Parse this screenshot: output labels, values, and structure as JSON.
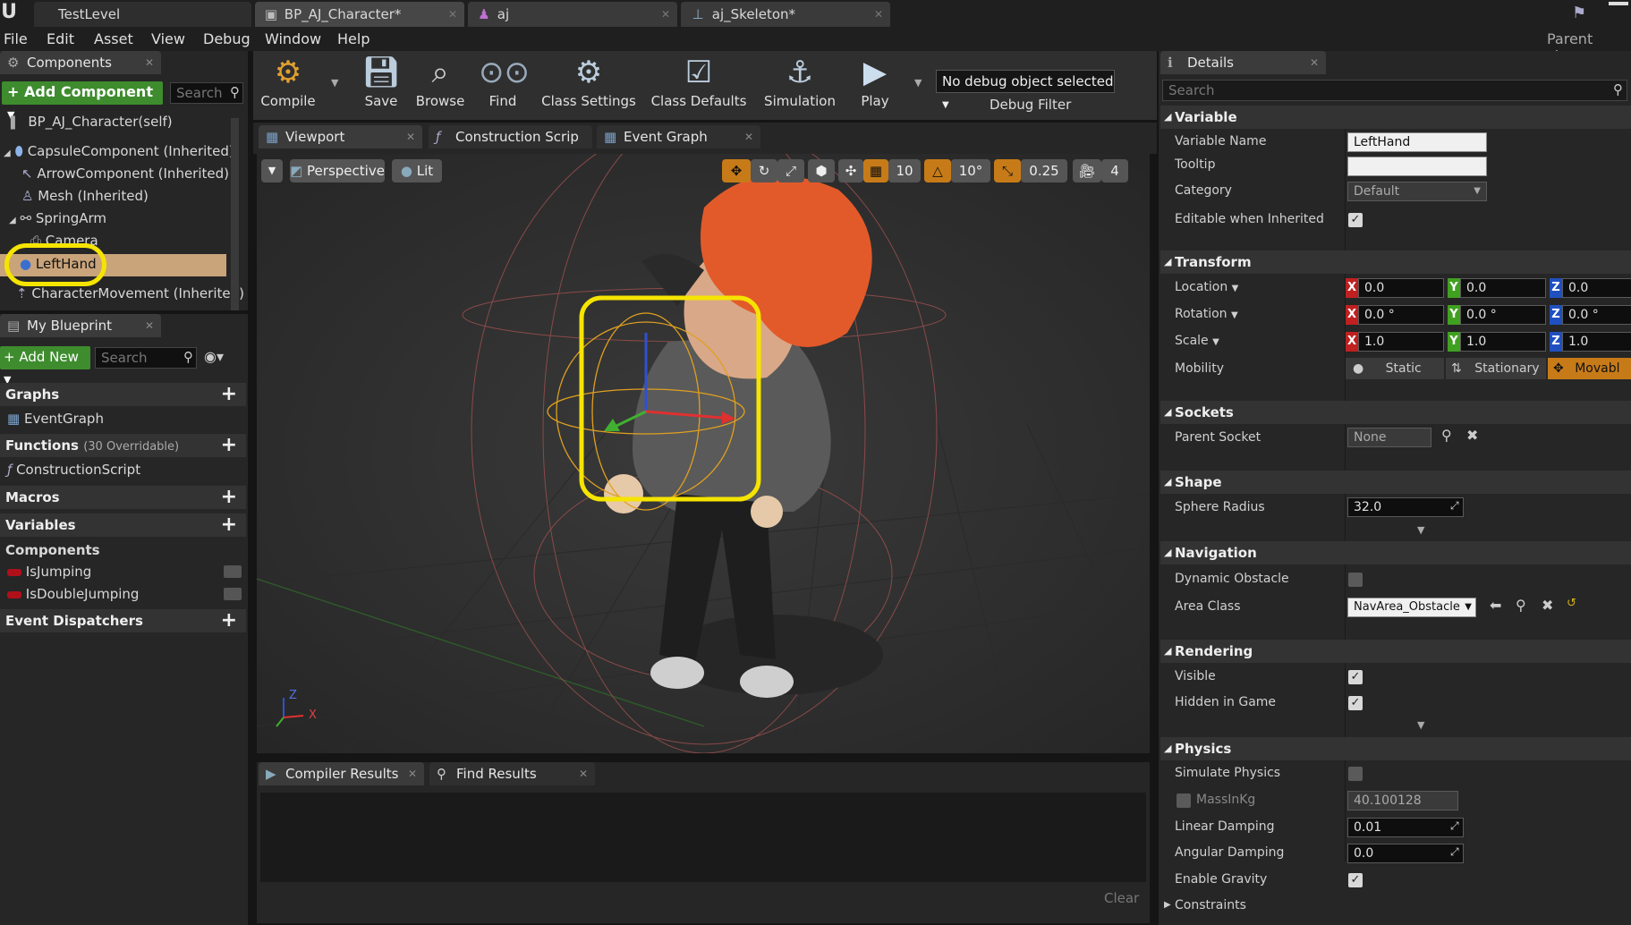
{
  "title_tabs": [
    {
      "label": "TestLevel"
    },
    {
      "label": "BP_AJ_Character*"
    },
    {
      "label": "aj"
    },
    {
      "label": "aj_Skeleton*"
    }
  ],
  "menu": [
    "File",
    "Edit",
    "Asset",
    "View",
    "Debug",
    "Window",
    "Help"
  ],
  "parent_class_label": "Parent class:",
  "components_panel": {
    "tab_label": "Components",
    "add_component_label": "+ Add Component",
    "search_placeholder": "Search",
    "self_label": "BP_AJ_Character(self)",
    "items": [
      {
        "label": "CapsuleComponent (Inherited)"
      },
      {
        "label": "ArrowComponent (Inherited)"
      },
      {
        "label": "Mesh (Inherited)"
      },
      {
        "label": "SpringArm"
      },
      {
        "label": "Camera"
      },
      {
        "label": "LeftHand"
      },
      {
        "label": "CharacterMovement (Inherited)"
      }
    ]
  },
  "my_blueprint": {
    "tab_label": "My Blueprint",
    "add_new_label": "+ Add New",
    "search_placeholder": "Search",
    "graphs_label": "Graphs",
    "event_graph_label": "EventGraph",
    "functions_label": "Functions",
    "functions_count": "(30 Overridable)",
    "construction_script_label": "ConstructionScript",
    "macros_label": "Macros",
    "variables_label": "Variables",
    "components_label": "Components",
    "variables": [
      {
        "label": "IsJumping"
      },
      {
        "label": "IsDoubleJumping"
      }
    ],
    "event_dispatchers_label": "Event Dispatchers"
  },
  "toolbar": {
    "compile": "Compile",
    "save": "Save",
    "browse": "Browse",
    "find": "Find",
    "class_settings": "Class Settings",
    "class_defaults": "Class Defaults",
    "simulation": "Simulation",
    "play": "Play",
    "debug_object": "No debug object selected",
    "debug_filter": "Debug Filter"
  },
  "graph_tabs": [
    {
      "label": "Viewport"
    },
    {
      "label": "Construction Scrip"
    },
    {
      "label": "Event Graph"
    }
  ],
  "viewport": {
    "perspective_label": "Perspective",
    "lit_label": "Lit",
    "grid_snap": "10",
    "rotation_snap": "10°",
    "scale_snap": "0.25",
    "camera_speed": "4",
    "axis_x": "X",
    "axis_z": "Z"
  },
  "bottom_tabs": [
    {
      "label": "Compiler Results"
    },
    {
      "label": "Find Results"
    }
  ],
  "clear_label": "Clear",
  "details": {
    "tab_label": "Details",
    "search_placeholder": "Search",
    "variable_section": "Variable",
    "variable_name_label": "Variable Name",
    "variable_name_value": "LeftHand",
    "tooltip_label": "Tooltip",
    "category_label": "Category",
    "category_value": "Default",
    "editable_label": "Editable when Inherited",
    "transform_section": "Transform",
    "location_label": "Location",
    "location": [
      "0.0",
      "0.0",
      "0.0"
    ],
    "rotation_label": "Rotation",
    "rotation": [
      "0.0 °",
      "0.0 °",
      "0.0 °"
    ],
    "scale_label": "Scale",
    "scale": [
      "1.0",
      "1.0",
      "1.0"
    ],
    "axis_labels": [
      "X",
      "Y",
      "Z"
    ],
    "mobility_label": "Mobility",
    "mobility_options": [
      "Static",
      "Stationary",
      "Movabl"
    ],
    "sockets_section": "Sockets",
    "parent_socket_label": "Parent Socket",
    "parent_socket_value": "None",
    "shape_section": "Shape",
    "sphere_radius_label": "Sphere Radius",
    "sphere_radius_value": "32.0",
    "navigation_section": "Navigation",
    "dynamic_obstacle_label": "Dynamic Obstacle",
    "area_class_label": "Area Class",
    "area_class_value": "NavArea_Obstacle",
    "rendering_section": "Rendering",
    "visible_label": "Visible",
    "hidden_in_game_label": "Hidden in Game",
    "physics_section": "Physics",
    "simulate_physics_label": "Simulate Physics",
    "mass_label": "MassInKg",
    "mass_value": "40.100128",
    "linear_damping_label": "Linear Damping",
    "linear_damping_value": "0.01",
    "angular_damping_label": "Angular Damping",
    "angular_damping_value": "0.0",
    "enable_gravity_label": "Enable Gravity",
    "constraints_label": "Constraints"
  },
  "colors": {
    "highlight_yellow": "#f5e400",
    "selected_row": "#c9a37a",
    "accent_green": "#3e8c2e",
    "accent_orange": "#c77b18"
  }
}
